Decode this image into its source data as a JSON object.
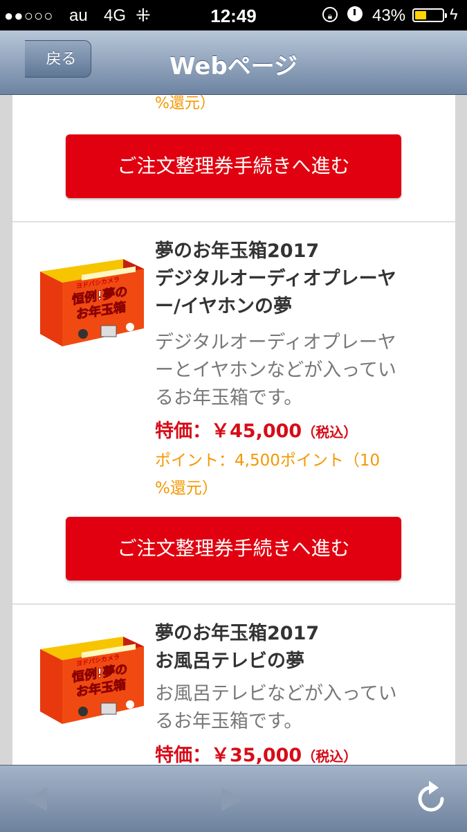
{
  "status_bar": {
    "signal": "●●○○○",
    "carrier": "au",
    "network": "4G",
    "time": "12:49",
    "battery_percent": "43%",
    "battery_level": 0.43
  },
  "nav": {
    "back_label": "戻る",
    "title": "Webページ"
  },
  "items_partial_top": {
    "points_tail": "%還元）"
  },
  "buttons": {
    "order_label": "ご注文整理券手続きへ進む"
  },
  "items": [
    {
      "name_line1": "夢のお年玉箱2017",
      "name_line2": "デジタルオーディオプレーヤ",
      "name_line3": "ー/イヤホンの夢",
      "desc_line1": "デジタルオーディオプレーヤ",
      "desc_line2": "ーとイヤホンなどが入ってい",
      "desc_line3": "るお年玉箱です。",
      "price_label": "特価：￥45,000",
      "price_tax": "（税込）",
      "points_line1": "ポイント：4,500ポイント（10",
      "points_line2": "%還元）",
      "box_banner": "デジタルオーディオプレーヤー/イヤホンの夢"
    },
    {
      "name_line1": "夢のお年玉箱2017",
      "name_line2": "お風呂テレビの夢",
      "desc_line1": "お風呂テレビなどが入ってい",
      "desc_line2": "るお年玉箱です。",
      "price_label": "特価：￥35,000",
      "price_tax": "（税込）",
      "box_banner": "お風呂テレビの夢"
    }
  ],
  "box_art": {
    "logo": "ヨドバシカメラ",
    "headline_1": "恒例!夢の",
    "headline_2": "お年玉箱"
  },
  "toolbar": {
    "back_icon": "triangle-left",
    "forward_icon": "triangle-right",
    "reload_icon": "circular-arrow"
  },
  "colors": {
    "button_red": "#e1000f",
    "price_red": "#d70c18",
    "points_orange": "#f39800",
    "nav_blue": "#6d84a2"
  }
}
